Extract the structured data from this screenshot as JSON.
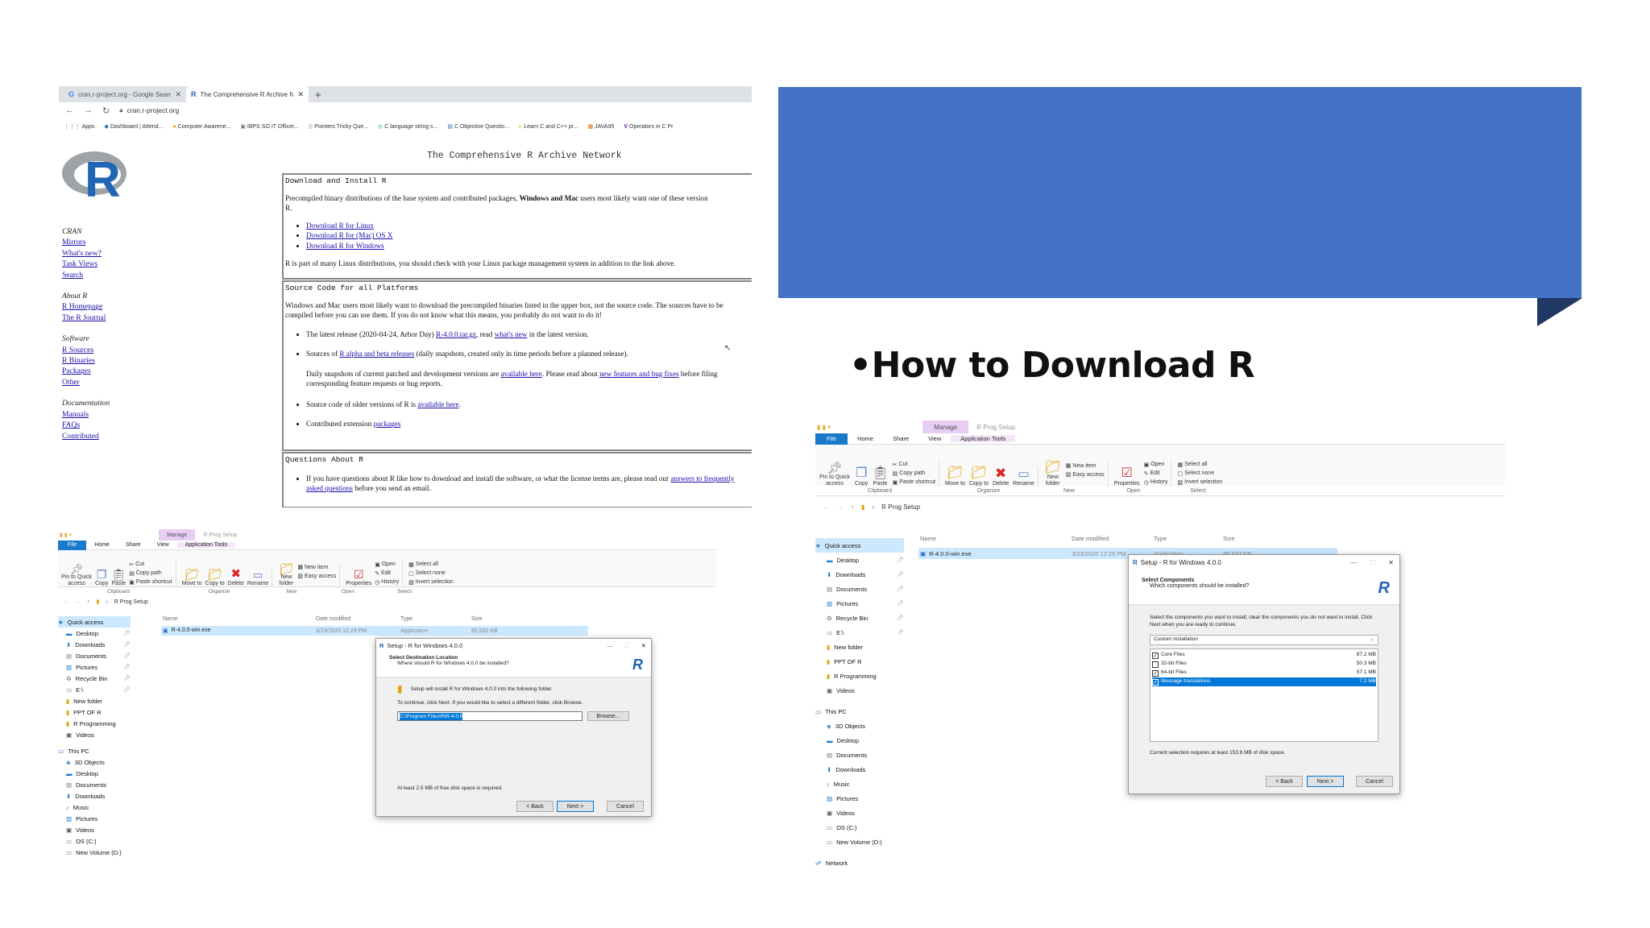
{
  "slide": {
    "title": "•How to Download R",
    "colors": {
      "banner": "#4472c4",
      "banner_tab": "#203864"
    }
  },
  "browser": {
    "tabs": [
      {
        "label": "cran.r-project.org - Google Searc"
      },
      {
        "label": "The Comprehensive R Archive N"
      }
    ],
    "new_tab": "+",
    "url": "cran.r-project.org",
    "bookmarks": [
      "Apps",
      "Dashboard | Attend...",
      "Computer Awarene...",
      "IBPS SO IT Officer...",
      "Pointers Tricky Que...",
      "C language string s...",
      "C Objective Questio...",
      "Learn C and C++ pr...",
      "JAVA95",
      "Operators in C Pr"
    ]
  },
  "cran": {
    "logo": "R",
    "title": "The Comprehensive R Archive Network",
    "sidebar": [
      {
        "heading": "CRAN",
        "links": [
          "Mirrors",
          "What's new?",
          "Task Views",
          "Search"
        ]
      },
      {
        "heading": "About R",
        "links": [
          "R Homepage",
          "The R Journal"
        ]
      },
      {
        "heading": "Software",
        "links": [
          "R Sources",
          "R Binaries",
          "Packages",
          "Other"
        ]
      },
      {
        "heading": "Documentation",
        "links": [
          "Manuals",
          "FAQs",
          "Contributed"
        ]
      }
    ],
    "download": {
      "heading": "Download and Install R",
      "intro_a": "Precompiled binary distributions of the base system and contributed packages, ",
      "intro_b": "Windows and Mac",
      "intro_c": " users most likely want one of these version",
      "intro_d": "R.",
      "links": [
        "Download R for Linux",
        "Download R for (Mac) OS X",
        "Download R for Windows"
      ],
      "note": "R is part of many Linux distributions, you should check with your Linux package management system in addition to the link above."
    },
    "source": {
      "heading": "Source Code for all Platforms",
      "intro": "Windows and Mac users most likely want to download the precompiled binaries listed in the upper box, not the source code. The sources have to be compiled before you can use them. If you do not know what this means, you probably do not want to do it!",
      "i1a": "The latest release (2020-04-24, Arbor Day) ",
      "i1link": "R-4.0.0.tar.gz",
      "i1b": ", read ",
      "i1link2": "what's new",
      "i1c": " in the latest version.",
      "i2a": "Sources of ",
      "i2link": "R alpha and beta releases",
      "i2b": " (daily snapshots, created only in time periods before a planned release).",
      "i3a": "Daily snapshots of current patched and development versions are ",
      "i3link": "available here",
      "i3b": ". Please read about ",
      "i3link2": "new features and bug fixes",
      "i3c": " before filing corresponding feature requests or bug reports.",
      "i4a": "Source code of older versions of R is ",
      "i4link": "available here",
      "i4b": ".",
      "i5a": "Contributed extension ",
      "i5link": "packages"
    },
    "questions": {
      "heading": "Questions About R",
      "q1a": "If you have questions about R like how to download and install the software, or what the license terms are, please read our ",
      "q1link": "answers to frequently asked questions",
      "q1b": " before you send an email."
    }
  },
  "explorer": {
    "quick_title": "R Prog Setup",
    "tabs": {
      "file": "File",
      "home": "Home",
      "share": "Share",
      "view": "View",
      "manage": "Manage",
      "app_tools": "Application Tools"
    },
    "ribbon": {
      "pin": "Pin to Quick access",
      "copy": "Copy",
      "paste": "Paste",
      "cut": "Cut",
      "copy_path": "Copy path",
      "paste_shortcut": "Paste shortcut",
      "move_to": "Move to",
      "copy_to": "Copy to",
      "delete": "Delete",
      "rename": "Rename",
      "new_folder": "New folder",
      "new_item": "New item",
      "easy_access": "Easy access",
      "properties": "Properties",
      "open": "Open",
      "edit": "Edit",
      "history": "History",
      "select_all": "Select all",
      "select_none": "Select none",
      "invert_selection": "Invert selection",
      "groups": {
        "clipboard": "Clipboard",
        "organize": "Organize",
        "new": "New",
        "open": "Open",
        "select": "Select"
      }
    },
    "breadcrumb": "R Prog Setup",
    "columns": {
      "name": "Name",
      "date": "Date modified",
      "type": "Type",
      "size": "Size"
    },
    "file": {
      "name": "R-4.0.0-win.exe",
      "date": "3/23/2020 12:29 PM",
      "type": "Application",
      "size": "85,532 KB"
    },
    "nav": {
      "quick_access": "Quick access",
      "quick_items": [
        "Desktop",
        "Downloads",
        "Documents",
        "Pictures",
        "Recycle Bin",
        "E:\\",
        "New folder",
        "PPT OF R",
        "R Programming",
        "Videos"
      ],
      "this_pc": "This PC",
      "pc_items": [
        "3D Objects",
        "Desktop",
        "Documents",
        "Downloads",
        "Music",
        "Pictures",
        "Videos",
        "OS (C:)",
        "New Volume (D:)"
      ],
      "network": "Network"
    }
  },
  "setup_dest": {
    "title": "Setup - R for Windows 4.0.0",
    "heading": "Select Destination Location",
    "sub": "Where should R for Windows 4.0.0 be installed?",
    "line1": "Setup will install R for Windows 4.0.0 into the following folder.",
    "line2": "To continue, click Next. If you would like to select a different folder, click Browse.",
    "path": "C:\\Program Files\\R\\R-4.0.0",
    "browse": "Browse...",
    "space": "At least 2.5 MB of free disk space is required.",
    "back": "< Back",
    "next": "Next >",
    "cancel": "Cancel"
  },
  "setup_comp": {
    "title": "Setup - R for Windows 4.0.0",
    "heading": "Select Components",
    "sub": "Which components should be installed?",
    "desc": "Select the components you want to install; clear the components you do not want to install. Click Next when you are ready to continue.",
    "install_type": "Custom installation",
    "components": [
      {
        "name": "Core Files",
        "size": "87.2 MB",
        "checked": true,
        "selected": false
      },
      {
        "name": "32-bit Files",
        "size": "50.3 MB",
        "checked": false,
        "selected": false
      },
      {
        "name": "64-bit Files",
        "size": "57.1 MB",
        "checked": true,
        "selected": false
      },
      {
        "name": "Message translations",
        "size": "7.2 MB",
        "checked": true,
        "selected": true
      }
    ],
    "space": "Current selection requires at least 153.9 MB of disk space.",
    "back": "< Back",
    "next": "Next >",
    "cancel": "Cancel"
  }
}
